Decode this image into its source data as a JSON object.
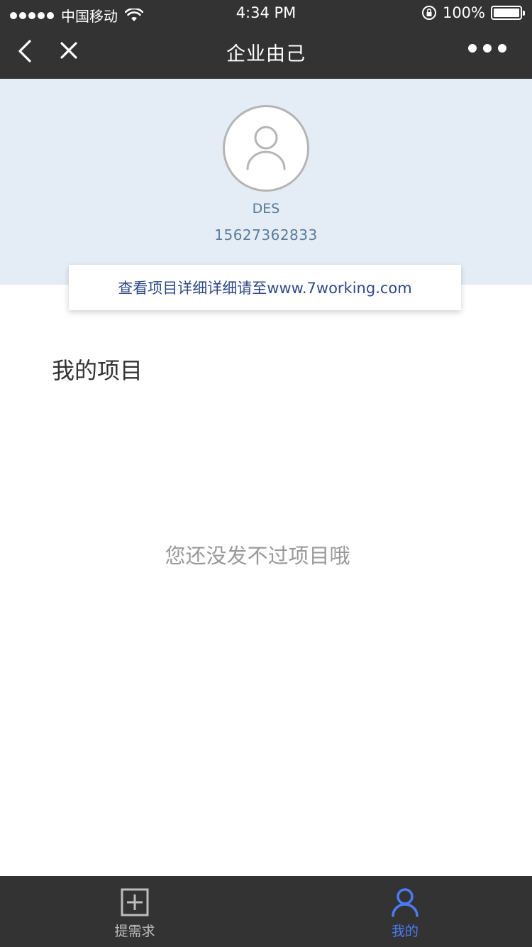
{
  "status_bar": {
    "carrier": "中国移动",
    "time": "4:34 PM",
    "battery": "100%"
  },
  "nav": {
    "title": "企业由己"
  },
  "profile": {
    "name": "DES",
    "phone": "15627362833"
  },
  "notice": {
    "text": "查看项目详细详细请至www.7working.com"
  },
  "section": {
    "title": "我的项目",
    "empty_text": "您还没发不过项目哦"
  },
  "tab_bar": {
    "items": [
      {
        "label": "提需求",
        "icon": "plus-square-icon",
        "active": false
      },
      {
        "label": "我的",
        "icon": "user-icon",
        "active": true
      }
    ]
  },
  "colors": {
    "header_bg": "#333333",
    "profile_bg": "#e4edf5",
    "accent": "#4a7bf7",
    "notice_text": "#2e4a86"
  }
}
